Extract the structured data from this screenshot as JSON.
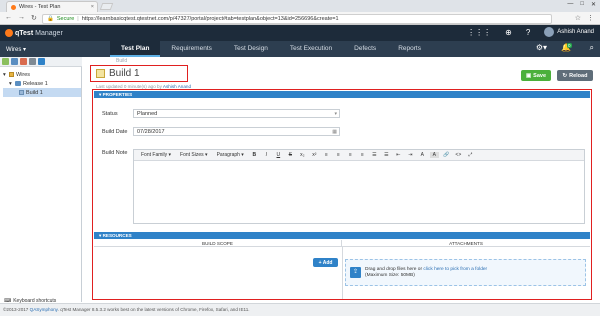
{
  "browser": {
    "tab_title": "Wires - Test Plan",
    "tab_close": "×",
    "window_controls": [
      "—",
      "□",
      "✕"
    ],
    "nav": [
      "←",
      "→",
      "↻"
    ],
    "secure_label": "Secure",
    "url": "https://learnbasicqtest.qtestnet.com/p/47327/portal/project#tab=testplan&object=13&id=256696&create=1",
    "url_right_icons": [
      "☆",
      "⋮"
    ]
  },
  "app": {
    "brand": "qTest",
    "brand_sub": "Manager",
    "user_name": "Ashish Anand",
    "header_icons": [
      "apps-icon",
      "download-icon",
      "help-icon"
    ],
    "project": "Wires ▾",
    "tabs": [
      "Test Plan",
      "Requirements",
      "Test Design",
      "Test Execution",
      "Defects",
      "Reports"
    ],
    "active_tab": "Test Plan",
    "notification_count": "0"
  },
  "tree": {
    "items": [
      {
        "label": "Wires",
        "level": 0,
        "icon": "folder-icon"
      },
      {
        "label": "Release 1",
        "level": 1,
        "icon": "release-icon"
      },
      {
        "label": "Build 1",
        "level": 2,
        "icon": "build-icon",
        "selected": true
      }
    ],
    "keyboard_shortcuts": "Keyboard shortcuts"
  },
  "content": {
    "breadcrumb": "Build",
    "title": "Build 1",
    "last_updated": "Last updated 0 minute(s) ago by",
    "last_updated_user": "Ashish Anand",
    "save_label": "Save",
    "reload_label": "Reload",
    "properties_header": "PROPERTIES",
    "status_label": "Status",
    "status_value": "Planned",
    "build_date_label": "Build Date",
    "build_date_value": "07/28/2017",
    "build_note_label": "Build Note",
    "editor_toolbar": {
      "font_family": "Font Family",
      "font_sizes": "Font Sizes",
      "paragraph": "Paragraph",
      "buttons": [
        "B",
        "I",
        "U",
        "S",
        "x₂",
        "x²",
        "≡",
        "≡",
        "≡",
        "≡",
        "☰",
        "☰",
        "⇤",
        "⇥",
        "A",
        "A",
        "🔗",
        "<>",
        "⤢"
      ]
    },
    "resources_header": "RESOURCES",
    "build_scope_label": "BUILD SCOPE",
    "attachments_label": "ATTACHMENTS",
    "add_label": "+ Add",
    "drop_text_1": "Drag and drop files here or",
    "drop_link": "click here to pick from a folder",
    "drop_text_2": "(Maximum Size: 50MB)"
  },
  "footer": {
    "copyright": "©2013-2017",
    "company": "QASymphony",
    "notice": ". qTest Manager 8.5.3.2 works best on the latest versions of Chrome, Firefox, Safari, and IE11."
  },
  "colors": {
    "header_bg": "#1d2b3a",
    "nav_bg": "#2d3e50",
    "section_blue": "#2f82c8",
    "save_green": "#4bb03b",
    "highlight_red": "#e02020"
  }
}
